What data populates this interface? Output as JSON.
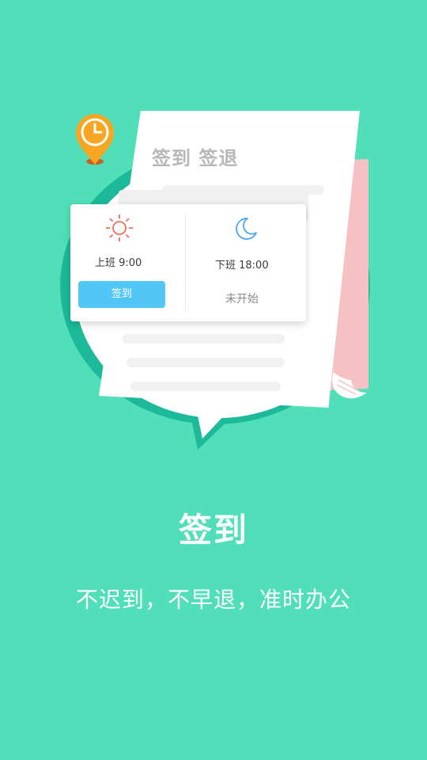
{
  "illustration": {
    "doc_heading": "签到 签退",
    "card": {
      "start_time": "上班 9:00",
      "end_time": "下班 18:00",
      "checkin_button": "签到",
      "end_status": "未开始"
    }
  },
  "title": "签到",
  "subtitle": "不迟到，不早退，准时办公",
  "icons": [
    "sun-icon",
    "moon-icon",
    "clock-icon",
    "location-pin-icon"
  ],
  "colors": {
    "background": "#50dfb9",
    "ring": "#1cb99a",
    "button": "#52c7f7",
    "sun": "#f26b55",
    "moon": "#4aa8f0",
    "pin": "#f6a623"
  }
}
